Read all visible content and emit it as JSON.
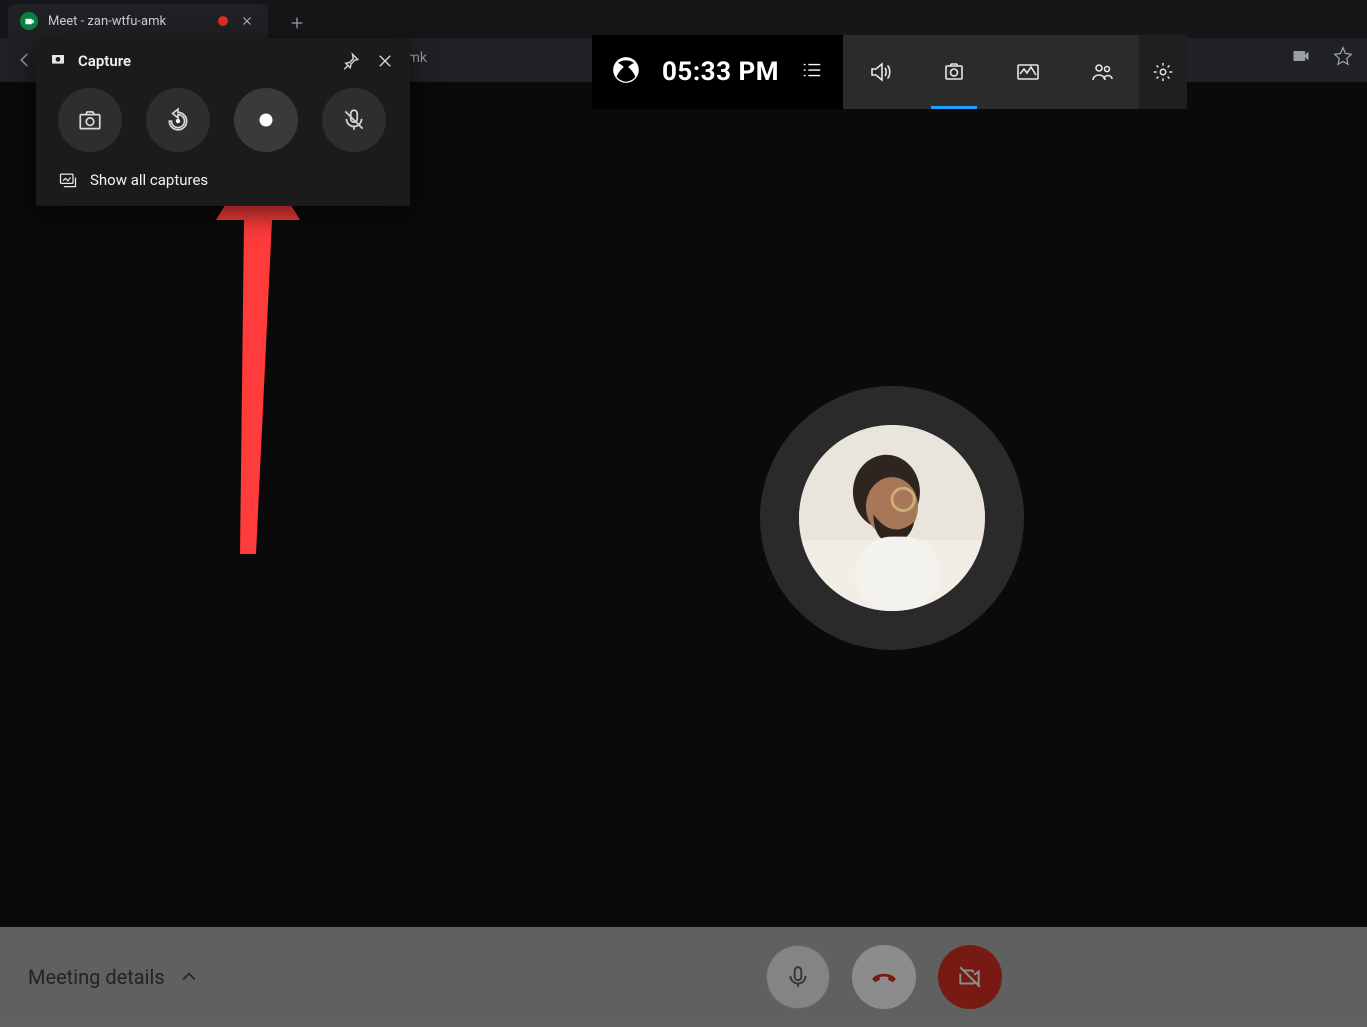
{
  "tab": {
    "title": "Meet - zan-wtfu-amk"
  },
  "address_fragment": "amk",
  "capture": {
    "title": "Capture",
    "show_all": "Show all captures",
    "buttons": {
      "screenshot": "screenshot-icon",
      "replay": "replay-icon",
      "record": "record-icon",
      "mic_off": "mic-off-icon"
    }
  },
  "gamebar": {
    "time": "05:33 PM",
    "items": {
      "audio": "audio-icon",
      "capture": "capture-icon",
      "performance": "performance-icon",
      "social": "social-icon"
    }
  },
  "bottom": {
    "meeting_details": "Meeting details"
  }
}
